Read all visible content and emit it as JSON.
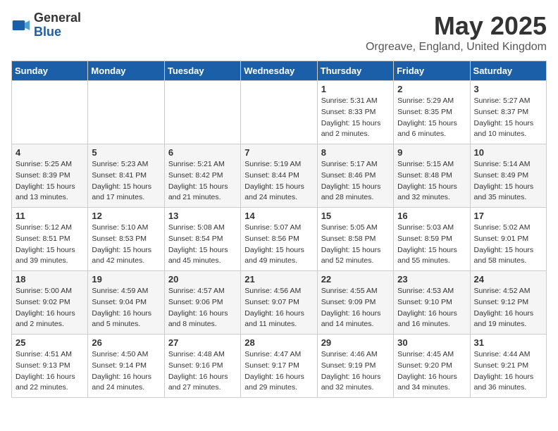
{
  "logo": {
    "general": "General",
    "blue": "Blue"
  },
  "title": {
    "month_year": "May 2025",
    "location": "Orgreave, England, United Kingdom"
  },
  "headers": [
    "Sunday",
    "Monday",
    "Tuesday",
    "Wednesday",
    "Thursday",
    "Friday",
    "Saturday"
  ],
  "weeks": [
    [
      {
        "day": "",
        "info": ""
      },
      {
        "day": "",
        "info": ""
      },
      {
        "day": "",
        "info": ""
      },
      {
        "day": "",
        "info": ""
      },
      {
        "day": "1",
        "info": "Sunrise: 5:31 AM\nSunset: 8:33 PM\nDaylight: 15 hours\nand 2 minutes."
      },
      {
        "day": "2",
        "info": "Sunrise: 5:29 AM\nSunset: 8:35 PM\nDaylight: 15 hours\nand 6 minutes."
      },
      {
        "day": "3",
        "info": "Sunrise: 5:27 AM\nSunset: 8:37 PM\nDaylight: 15 hours\nand 10 minutes."
      }
    ],
    [
      {
        "day": "4",
        "info": "Sunrise: 5:25 AM\nSunset: 8:39 PM\nDaylight: 15 hours\nand 13 minutes."
      },
      {
        "day": "5",
        "info": "Sunrise: 5:23 AM\nSunset: 8:41 PM\nDaylight: 15 hours\nand 17 minutes."
      },
      {
        "day": "6",
        "info": "Sunrise: 5:21 AM\nSunset: 8:42 PM\nDaylight: 15 hours\nand 21 minutes."
      },
      {
        "day": "7",
        "info": "Sunrise: 5:19 AM\nSunset: 8:44 PM\nDaylight: 15 hours\nand 24 minutes."
      },
      {
        "day": "8",
        "info": "Sunrise: 5:17 AM\nSunset: 8:46 PM\nDaylight: 15 hours\nand 28 minutes."
      },
      {
        "day": "9",
        "info": "Sunrise: 5:15 AM\nSunset: 8:48 PM\nDaylight: 15 hours\nand 32 minutes."
      },
      {
        "day": "10",
        "info": "Sunrise: 5:14 AM\nSunset: 8:49 PM\nDaylight: 15 hours\nand 35 minutes."
      }
    ],
    [
      {
        "day": "11",
        "info": "Sunrise: 5:12 AM\nSunset: 8:51 PM\nDaylight: 15 hours\nand 39 minutes."
      },
      {
        "day": "12",
        "info": "Sunrise: 5:10 AM\nSunset: 8:53 PM\nDaylight: 15 hours\nand 42 minutes."
      },
      {
        "day": "13",
        "info": "Sunrise: 5:08 AM\nSunset: 8:54 PM\nDaylight: 15 hours\nand 45 minutes."
      },
      {
        "day": "14",
        "info": "Sunrise: 5:07 AM\nSunset: 8:56 PM\nDaylight: 15 hours\nand 49 minutes."
      },
      {
        "day": "15",
        "info": "Sunrise: 5:05 AM\nSunset: 8:58 PM\nDaylight: 15 hours\nand 52 minutes."
      },
      {
        "day": "16",
        "info": "Sunrise: 5:03 AM\nSunset: 8:59 PM\nDaylight: 15 hours\nand 55 minutes."
      },
      {
        "day": "17",
        "info": "Sunrise: 5:02 AM\nSunset: 9:01 PM\nDaylight: 15 hours\nand 58 minutes."
      }
    ],
    [
      {
        "day": "18",
        "info": "Sunrise: 5:00 AM\nSunset: 9:02 PM\nDaylight: 16 hours\nand 2 minutes."
      },
      {
        "day": "19",
        "info": "Sunrise: 4:59 AM\nSunset: 9:04 PM\nDaylight: 16 hours\nand 5 minutes."
      },
      {
        "day": "20",
        "info": "Sunrise: 4:57 AM\nSunset: 9:06 PM\nDaylight: 16 hours\nand 8 minutes."
      },
      {
        "day": "21",
        "info": "Sunrise: 4:56 AM\nSunset: 9:07 PM\nDaylight: 16 hours\nand 11 minutes."
      },
      {
        "day": "22",
        "info": "Sunrise: 4:55 AM\nSunset: 9:09 PM\nDaylight: 16 hours\nand 14 minutes."
      },
      {
        "day": "23",
        "info": "Sunrise: 4:53 AM\nSunset: 9:10 PM\nDaylight: 16 hours\nand 16 minutes."
      },
      {
        "day": "24",
        "info": "Sunrise: 4:52 AM\nSunset: 9:12 PM\nDaylight: 16 hours\nand 19 minutes."
      }
    ],
    [
      {
        "day": "25",
        "info": "Sunrise: 4:51 AM\nSunset: 9:13 PM\nDaylight: 16 hours\nand 22 minutes."
      },
      {
        "day": "26",
        "info": "Sunrise: 4:50 AM\nSunset: 9:14 PM\nDaylight: 16 hours\nand 24 minutes."
      },
      {
        "day": "27",
        "info": "Sunrise: 4:48 AM\nSunset: 9:16 PM\nDaylight: 16 hours\nand 27 minutes."
      },
      {
        "day": "28",
        "info": "Sunrise: 4:47 AM\nSunset: 9:17 PM\nDaylight: 16 hours\nand 29 minutes."
      },
      {
        "day": "29",
        "info": "Sunrise: 4:46 AM\nSunset: 9:19 PM\nDaylight: 16 hours\nand 32 minutes."
      },
      {
        "day": "30",
        "info": "Sunrise: 4:45 AM\nSunset: 9:20 PM\nDaylight: 16 hours\nand 34 minutes."
      },
      {
        "day": "31",
        "info": "Sunrise: 4:44 AM\nSunset: 9:21 PM\nDaylight: 16 hours\nand 36 minutes."
      }
    ]
  ]
}
